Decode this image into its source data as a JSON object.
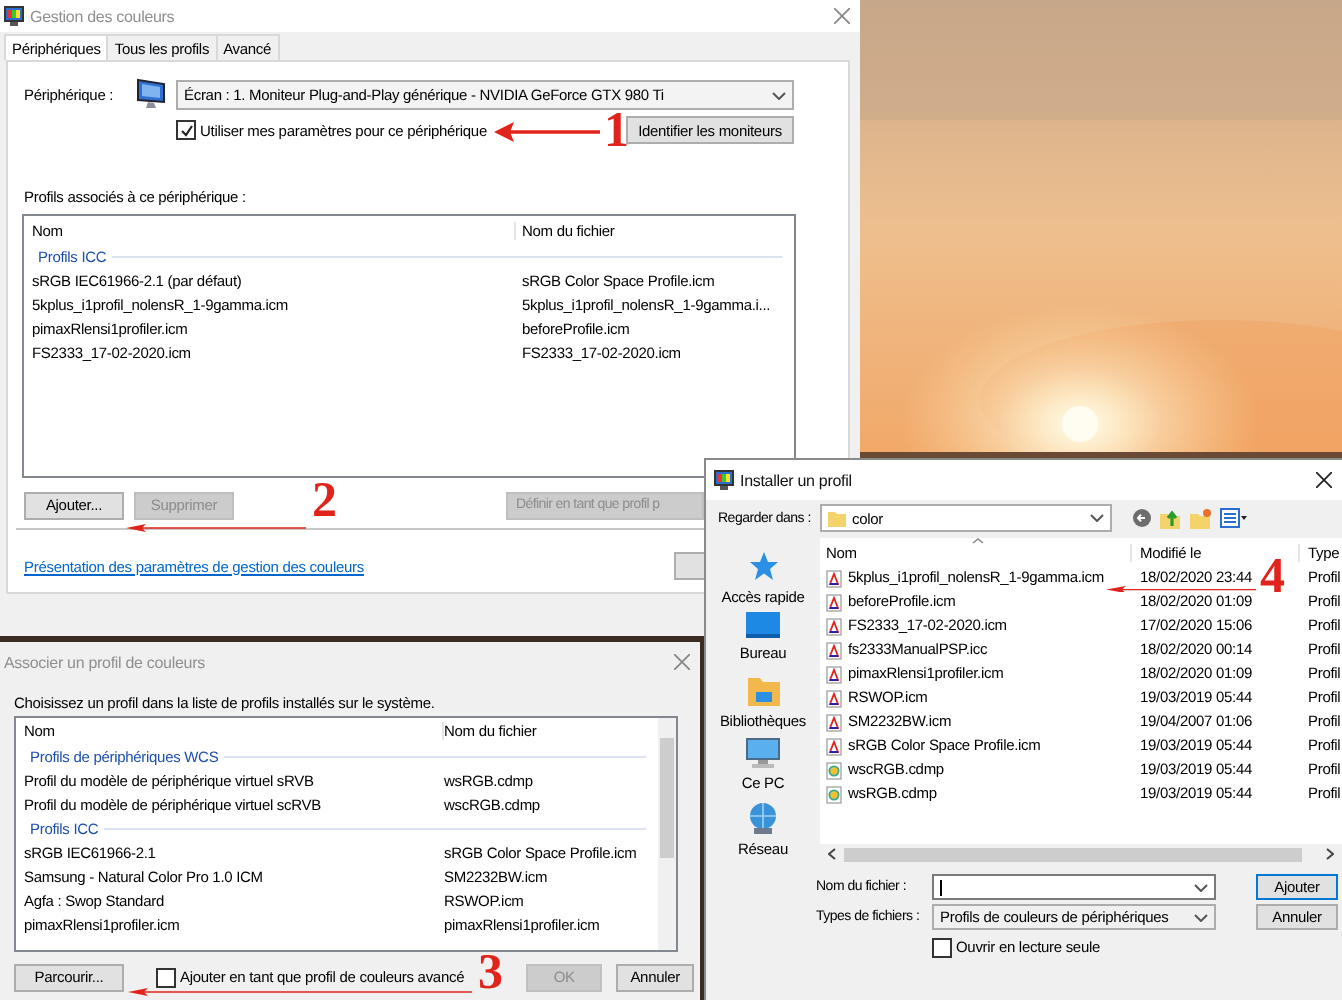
{
  "main_window": {
    "title": "Gestion des couleurs",
    "tabs": [
      {
        "label": "Périphériques",
        "selected": true
      },
      {
        "label": "Tous les profils",
        "selected": false
      },
      {
        "label": "Avancé",
        "selected": false
      }
    ],
    "device_label": "Périphérique :",
    "device_value": "Écran : 1. Moniteur Plug-and-Play générique - NVIDIA GeForce GTX 980 Ti",
    "use_settings": {
      "label": "Utiliser mes paramètres pour ce périphérique",
      "checked": true
    },
    "identify_button": "Identifier les moniteurs",
    "profiles_label": "Profils associés à ce périphérique :",
    "columns": [
      "Nom",
      "Nom du fichier"
    ],
    "groups": [
      {
        "name": "Profils ICC",
        "rows": [
          {
            "name": "sRGB IEC61966-2.1 (par défaut)",
            "file": "sRGB Color Space Profile.icm"
          },
          {
            "name": "5kplus_i1profil_nolensR_1-9gamma.icm",
            "file": "5kplus_i1profil_nolensR_1-9gamma.i..."
          },
          {
            "name": "pimaxRlensi1profiler.icm",
            "file": "beforeProfile.icm"
          },
          {
            "name": "FS2333_17-02-2020.icm",
            "file": "FS2333_17-02-2020.icm"
          }
        ]
      }
    ],
    "buttons": [
      {
        "label": "Ajouter...",
        "disabled": false
      },
      {
        "label": "Supprimer",
        "disabled": true
      },
      {
        "label": "Définir en tant que profil p",
        "disabled": true
      }
    ],
    "link": "Présentation des paramètres de gestion des couleurs"
  },
  "associate_dialog": {
    "title": "Associer un profil de couleurs",
    "instruction": "Choisissez un profil dans la liste de profils installés sur le système.",
    "columns": [
      "Nom",
      "Nom du fichier"
    ],
    "groups": [
      {
        "name": "Profils de périphériques WCS",
        "rows": [
          {
            "name": "Profil du modèle de périphérique virtuel sRVB",
            "file": "wsRGB.cdmp"
          },
          {
            "name": "Profil du modèle de périphérique virtuel scRVB",
            "file": "wscRGB.cdmp"
          }
        ]
      },
      {
        "name": "Profils ICC",
        "rows": [
          {
            "name": "sRGB IEC61966-2.1",
            "file": "sRGB Color Space Profile.icm"
          },
          {
            "name": "Samsung - Natural Color Pro 1.0 ICM",
            "file": "SM2232BW.icm"
          },
          {
            "name": "Agfa : Swop Standard",
            "file": "RSWOP.icm"
          },
          {
            "name": "pimaxRlensi1profiler.icm",
            "file": "pimaxRlensi1profiler.icm"
          }
        ]
      }
    ],
    "browse_button": "Parcourir...",
    "advanced": {
      "label": "Ajouter en tant que profil de couleurs avancé",
      "checked": false
    },
    "buttons": [
      {
        "label": "OK",
        "disabled": true
      },
      {
        "label": "Annuler",
        "disabled": false
      }
    ]
  },
  "install_dialog": {
    "title": "Installer un profil",
    "look_in_label": "Regarder dans :",
    "folder": "color",
    "places": [
      "Accès rapide",
      "Bureau",
      "Bibliothèques",
      "Ce PC",
      "Réseau"
    ],
    "columns": [
      "Nom",
      "Modifié le",
      "Type"
    ],
    "files": [
      {
        "name": "5kplus_i1profil_nolensR_1-9gamma.icm",
        "modified": "18/02/2020 23:44",
        "type": "Profil",
        "kind": "icc"
      },
      {
        "name": "beforeProfile.icm",
        "modified": "18/02/2020 01:09",
        "type": "Profil",
        "kind": "icc"
      },
      {
        "name": "FS2333_17-02-2020.icm",
        "modified": "17/02/2020 15:06",
        "type": "Profil",
        "kind": "icc"
      },
      {
        "name": "fs2333ManualPSP.icc",
        "modified": "18/02/2020 00:14",
        "type": "Profil",
        "kind": "icc"
      },
      {
        "name": "pimaxRlensi1profiler.icm",
        "modified": "18/02/2020 01:09",
        "type": "Profil",
        "kind": "icc"
      },
      {
        "name": "RSWOP.icm",
        "modified": "19/03/2019 05:44",
        "type": "Profil",
        "kind": "icc"
      },
      {
        "name": "SM2232BW.icm",
        "modified": "19/04/2007 01:06",
        "type": "Profil",
        "kind": "icc"
      },
      {
        "name": "sRGB Color Space Profile.icm",
        "modified": "19/03/2019 05:44",
        "type": "Profil",
        "kind": "icc"
      },
      {
        "name": "wscRGB.cdmp",
        "modified": "19/03/2019 05:44",
        "type": "Profil",
        "kind": "cdmp"
      },
      {
        "name": "wsRGB.cdmp",
        "modified": "19/03/2019 05:44",
        "type": "Profil",
        "kind": "cdmp"
      }
    ],
    "filename_label": "Nom du fichier :",
    "filetype_label": "Types de fichiers :",
    "filetype_value": "Profils de couleurs de périphériques",
    "readonly": {
      "label": "Ouvrir en lecture seule",
      "checked": false
    },
    "buttons": [
      {
        "label": "Ajouter",
        "default": true
      },
      {
        "label": "Annuler",
        "default": false
      }
    ]
  },
  "annotations": [
    {
      "number": "1"
    },
    {
      "number": "2"
    },
    {
      "number": "3"
    },
    {
      "number": "4"
    }
  ]
}
